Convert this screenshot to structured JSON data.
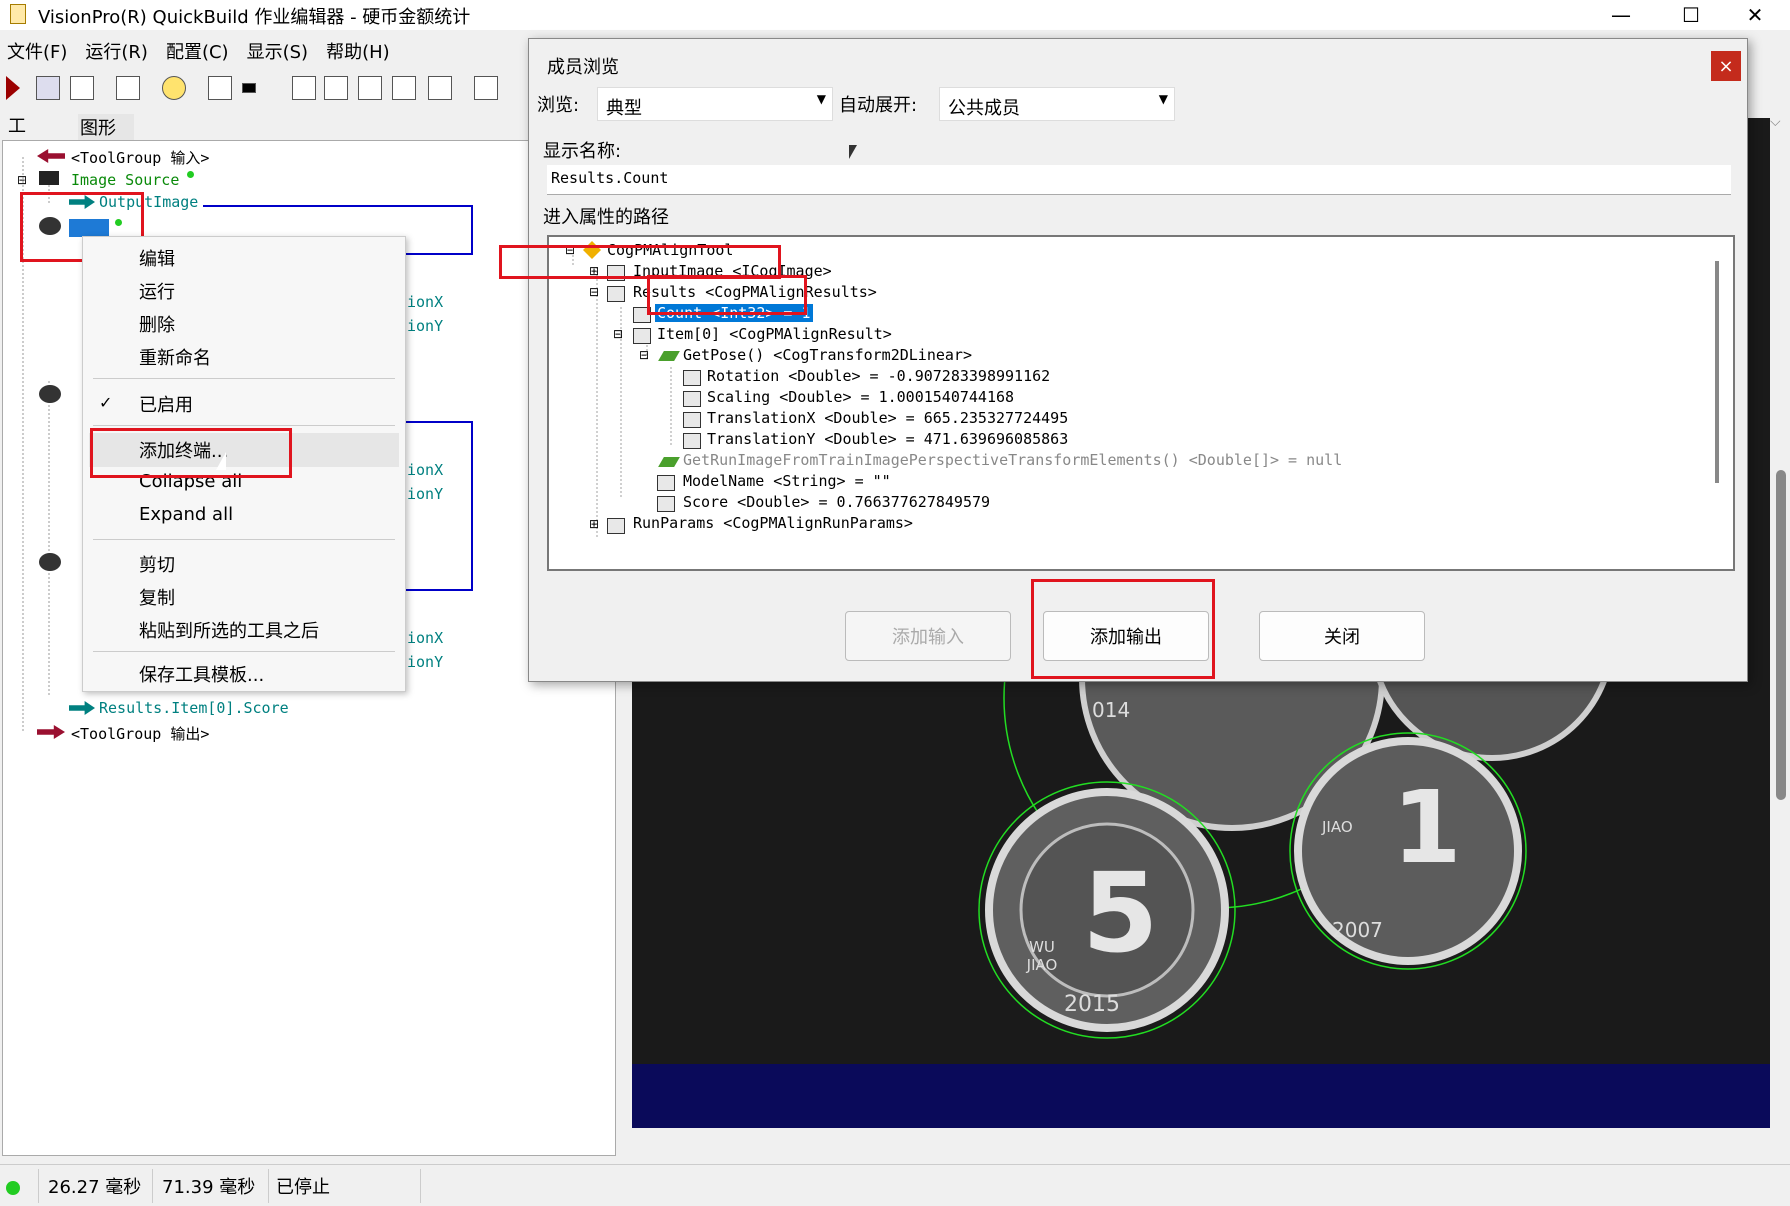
{
  "window": {
    "title": "VisionPro(R) QuickBuild 作业编辑器 - 硬币金额统计"
  },
  "menu": [
    "文件(F)",
    "运行(R)",
    "配置(C)",
    "显示(S)",
    "帮助(H)"
  ],
  "tabs": [
    "工具",
    "图形"
  ],
  "tree": {
    "toolgroup_input": "<ToolGroup 输入>",
    "image_source": "Image Source",
    "output_image": "OutputImage",
    "results_score": "Results.Item[0].Score",
    "toolgroup_output": "<ToolGroup 输出>",
    "side_labels": [
      "ionX",
      "ionY",
      "ionX",
      "ionY",
      "ionX",
      "ionY"
    ]
  },
  "context_menu": {
    "items": [
      "编辑",
      "运行",
      "删除",
      "重新命名",
      "已启用",
      "添加终端...",
      "Collapse all",
      "Expand all",
      "剪切",
      "复制",
      "粘贴到所选的工具之后",
      "保存工具模板..."
    ]
  },
  "dialog": {
    "title": "成员浏览",
    "close": "×",
    "browse_label": "浏览:",
    "browse_value": "典型",
    "expand_label": "自动展开:",
    "expand_value": "公共成员",
    "display_name_label": "显示名称:",
    "display_name_value": "Results.Count",
    "path_label": "进入属性的路径",
    "tree": [
      "CogPMAlignTool",
      "InputImage <ICogImage>",
      "Results <CogPMAlignResults>",
      "Count <Int32> = 1",
      "Item[0] <CogPMAlignResult>",
      "GetPose() <CogTransform2DLinear>",
      "Rotation <Double> = -0.907283398991162",
      "Scaling <Double> = 1.0001540744168",
      "TranslationX <Double> = 665.235327724495",
      "TranslationY <Double> = 471.639696085863",
      "GetRunImageFromTrainImagePerspectiveTransformElements() <Double[]> = null",
      "ModelName <String> = \"\"",
      "Score <Double> = 0.766377627849579",
      "RunParams <CogPMAlignRunParams>"
    ],
    "buttons": {
      "add_input": "添加输入",
      "add_output": "添加输出",
      "close": "关闭"
    }
  },
  "coins": {
    "labels": [
      "5",
      "WU JIAO",
      "2015",
      "1",
      "JIAO",
      "2007",
      "014"
    ]
  },
  "status": {
    "time1": "26.27 毫秒",
    "time2": "71.39 毫秒",
    "state": "已停止"
  },
  "colors": {
    "highlight": "#0078d7",
    "redbox": "#e0141e",
    "navy": "#0a0a5a",
    "coin_circle": "#22dd22"
  }
}
